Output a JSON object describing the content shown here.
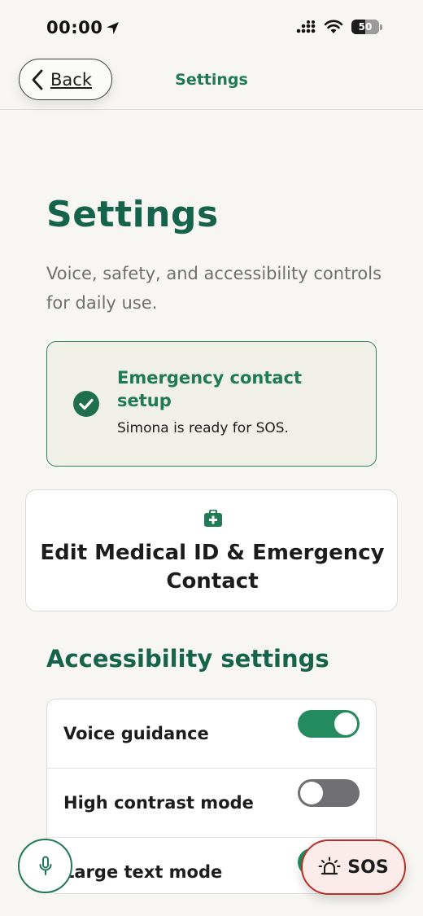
{
  "status_bar": {
    "time": "00:00",
    "battery_level": "50",
    "icons": [
      "location-arrow-icon",
      "cellular-signal-icon",
      "wifi-icon",
      "battery-icon"
    ]
  },
  "nav": {
    "back_label": "Back",
    "title": "Settings"
  },
  "page": {
    "title": "Settings",
    "subtitle": "Voice, safety, and accessibility controls for daily use."
  },
  "emergency_card": {
    "title": "Emergency contact setup",
    "description": "Simona  is ready for SOS.",
    "icon": "check-circle-icon"
  },
  "medical_button": {
    "label": "Edit Medical ID & Emergency Contact",
    "icon": "medical-kit-icon"
  },
  "accessibility": {
    "title": "Accessibility settings",
    "items": [
      {
        "label": "Voice guidance",
        "enabled": true
      },
      {
        "label": "High contrast mode",
        "enabled": false
      },
      {
        "label": "Large text mode",
        "enabled": true
      }
    ]
  },
  "floating": {
    "mic_icon": "microphone-icon",
    "sos_label": "SOS",
    "sos_icon": "siren-icon"
  },
  "colors": {
    "accent_green": "#1f7a55",
    "heading_green": "#14634a",
    "toggle_on": "#248a5f",
    "toggle_off": "#6f6f74",
    "sos_border": "#b8302a",
    "background": "#f7f6f2"
  }
}
